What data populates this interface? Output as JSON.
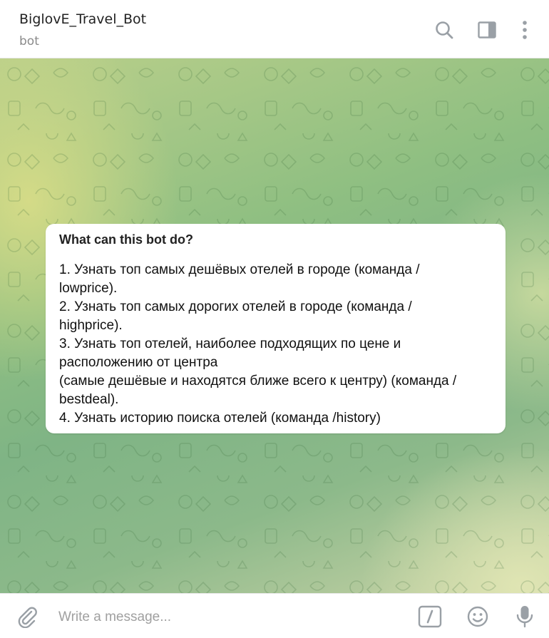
{
  "header": {
    "title": "BiglovE_Travel_Bot",
    "subtitle": "bot",
    "icons": [
      "search-icon",
      "sidebar-icon",
      "more-icon"
    ]
  },
  "chat": {
    "intro": {
      "title": "What can this bot do?",
      "lines": [
        "1. Узнать топ самых дешёвых отелей в городе (команда /",
        "lowprice).",
        "2. Узнать топ самых дорогих отелей в городе (команда /",
        "highprice).",
        "3. Узнать топ отелей, наиболее подходящих по цене и",
        "расположению от центра",
        "(самые дешёвые и находятся ближе всего к центру) (команда /",
        "bestdeal).",
        "4. Узнать историю поиска отелей (команда /history)"
      ]
    }
  },
  "composer": {
    "placeholder": "Write a message...",
    "icons": [
      "attach-icon",
      "commands-icon",
      "emoji-icon",
      "microphone-icon"
    ]
  },
  "colors": {
    "icon": "#9aa0a6",
    "accent_bg_green": "#8fbf82",
    "accent_bg_yellow": "#d7dc87"
  }
}
